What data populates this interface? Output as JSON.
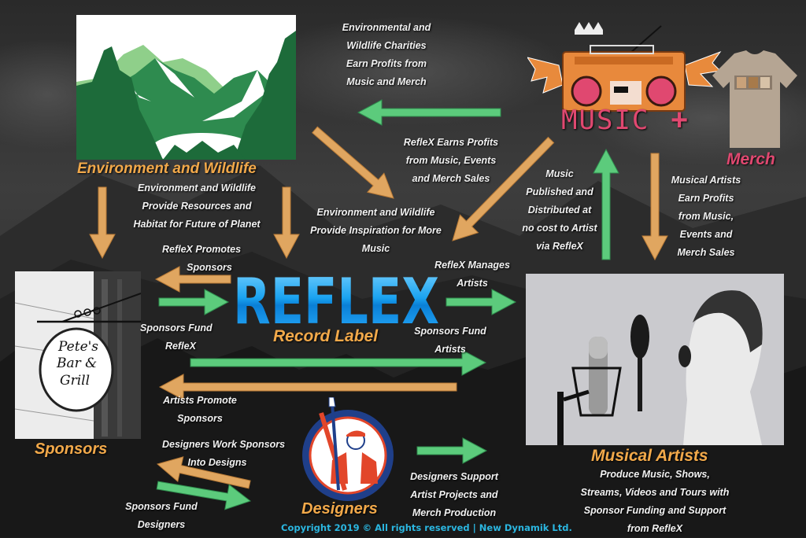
{
  "colors": {
    "background": "#1c1c1c",
    "title_orange": "#f2a94a",
    "arrow_orange": "#e0a660",
    "arrow_green": "#4dbb6e",
    "logo_blue": "#1aa3f0",
    "music_pink": "#e04870",
    "copyright_cyan": "#2bb6e0"
  },
  "nodes": {
    "environment": {
      "title": "Environment and Wildlife",
      "image_icon": "mountains-forest-icon"
    },
    "music": {
      "title": "MUSIC",
      "image_icon": "winged-boombox-icon"
    },
    "plus": "+",
    "merch": {
      "title": "Merch",
      "image_icon": "tshirt-icon"
    },
    "reflex": {
      "logo": "REFLEX",
      "subtitle": "Record Label"
    },
    "sponsors": {
      "title": "Sponsors",
      "sign_lines": [
        "Pete's",
        "Bar &",
        "Grill"
      ],
      "image_icon": "hanging-sign-icon"
    },
    "artists": {
      "title": "Musical Artists",
      "image_icon": "singer-microphone-icon"
    },
    "designers": {
      "title": "Designers",
      "image_icon": "painter-emblem-icon"
    }
  },
  "labels": {
    "charities": [
      "Environmental and",
      "Wildlife Charities",
      "Earn Profits from",
      "Music and Merch"
    ],
    "env_resources": [
      "Environment and Wildlife",
      "Provide Resources and",
      "Habitat for Future of Planet"
    ],
    "reflex_earns": [
      "RefleX Earns Profits",
      "from Music, Events",
      "and Merch Sales"
    ],
    "env_inspiration": [
      "Environment and Wildlife",
      "Provide Inspiration for More",
      "Music"
    ],
    "music_published": [
      "Music",
      "Published and",
      "Distributed at",
      "no cost to Artist",
      "via RefleX"
    ],
    "artists_earn": [
      "Musical Artists",
      "Earn Profits",
      "from Music,",
      "Events and",
      "Merch Sales"
    ],
    "reflex_promotes": [
      "RefleX Promotes",
      "Sponsors"
    ],
    "sponsors_fund_reflex": [
      "Sponsors Fund",
      "RefleX"
    ],
    "reflex_manages": [
      "RefleX Manages",
      "Artists"
    ],
    "sponsors_fund_artists": [
      "Sponsors Fund",
      "Artists"
    ],
    "artists_promote": [
      "Artists Promote",
      "Sponsors"
    ],
    "designers_work": [
      "Designers Work Sponsors",
      "Into Designs"
    ],
    "sponsors_fund_designers": [
      "Sponsors Fund",
      "Designers"
    ],
    "designers_support": [
      "Designers Support",
      "Artist Projects and",
      "Merch Production"
    ],
    "artists_produce": [
      "Produce Music, Shows,",
      "Streams, Videos and Tours with",
      "Sponsor Funding and Support",
      "from RefleX"
    ]
  },
  "arrows": [
    {
      "name": "arrow-music-to-environment",
      "color": "green",
      "from": "music",
      "to": "environment"
    },
    {
      "name": "arrow-environment-to-sponsors",
      "color": "orange",
      "from": "environment",
      "to": "sponsors"
    },
    {
      "name": "arrow-environment-to-reflex",
      "color": "orange",
      "from": "environment",
      "to": "reflex"
    },
    {
      "name": "arrow-environment-inspiration",
      "color": "orange",
      "from": "environment",
      "to": "reflex"
    },
    {
      "name": "arrow-music-to-reflex",
      "color": "orange",
      "from": "music",
      "to": "reflex"
    },
    {
      "name": "arrow-artists-to-music",
      "color": "green",
      "from": "artists",
      "to": "music"
    },
    {
      "name": "arrow-music-to-artists",
      "color": "orange",
      "from": "music",
      "to": "artists"
    },
    {
      "name": "arrow-reflex-to-sponsors",
      "color": "orange",
      "from": "reflex",
      "to": "sponsors"
    },
    {
      "name": "arrow-sponsors-to-reflex",
      "color": "green",
      "from": "sponsors",
      "to": "reflex"
    },
    {
      "name": "arrow-reflex-to-artists",
      "color": "green",
      "from": "reflex",
      "to": "artists"
    },
    {
      "name": "arrow-sponsors-to-artists",
      "color": "green",
      "from": "sponsors",
      "to": "artists"
    },
    {
      "name": "arrow-artists-to-sponsors",
      "color": "orange",
      "from": "artists",
      "to": "sponsors"
    },
    {
      "name": "arrow-designers-to-sponsors",
      "color": "orange",
      "from": "designers",
      "to": "sponsors"
    },
    {
      "name": "arrow-sponsors-to-designers",
      "color": "green",
      "from": "sponsors",
      "to": "designers"
    },
    {
      "name": "arrow-designers-to-artists",
      "color": "green",
      "from": "designers",
      "to": "artists"
    }
  ],
  "footer": {
    "copyright": "Copyright 2019 © All rights reserved | New Dynamik Ltd."
  }
}
